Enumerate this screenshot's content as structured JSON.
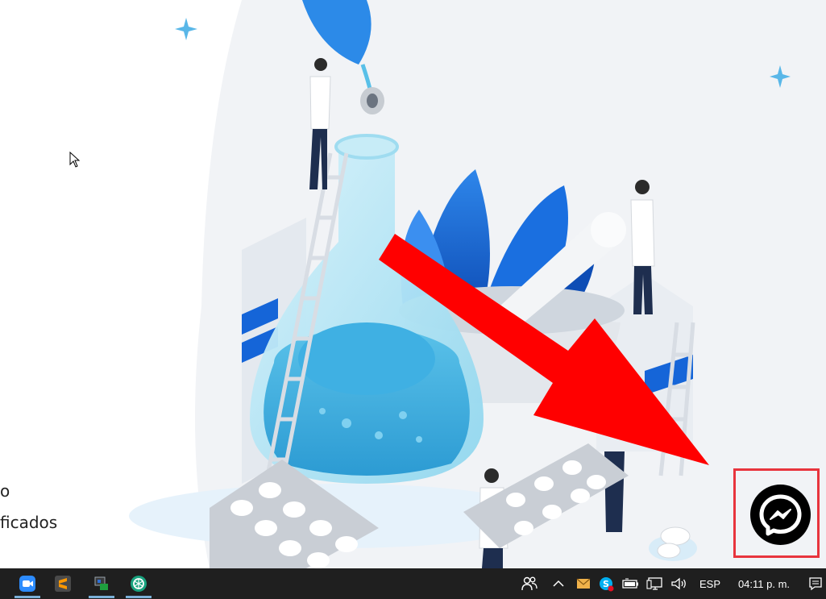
{
  "page": {
    "partial_heading": "o",
    "partial_text": "ficados"
  },
  "messenger": {
    "icon": "messenger-icon"
  },
  "taskbar": {
    "apps": [
      {
        "name": "zoom",
        "icon": "zoom-icon"
      },
      {
        "name": "sublime-text",
        "icon": "sublime-text-icon"
      },
      {
        "name": "vpn-app",
        "icon": "network-lock-icon"
      },
      {
        "name": "chatgpt",
        "icon": "openai-icon"
      }
    ],
    "language": "ESP",
    "clock": "04:11 p. m."
  },
  "colors": {
    "arrow": "#ff0000",
    "highlight_border": "#e8343d",
    "taskbar": "#1f1f1f",
    "accent_blue": "#1565d8"
  }
}
